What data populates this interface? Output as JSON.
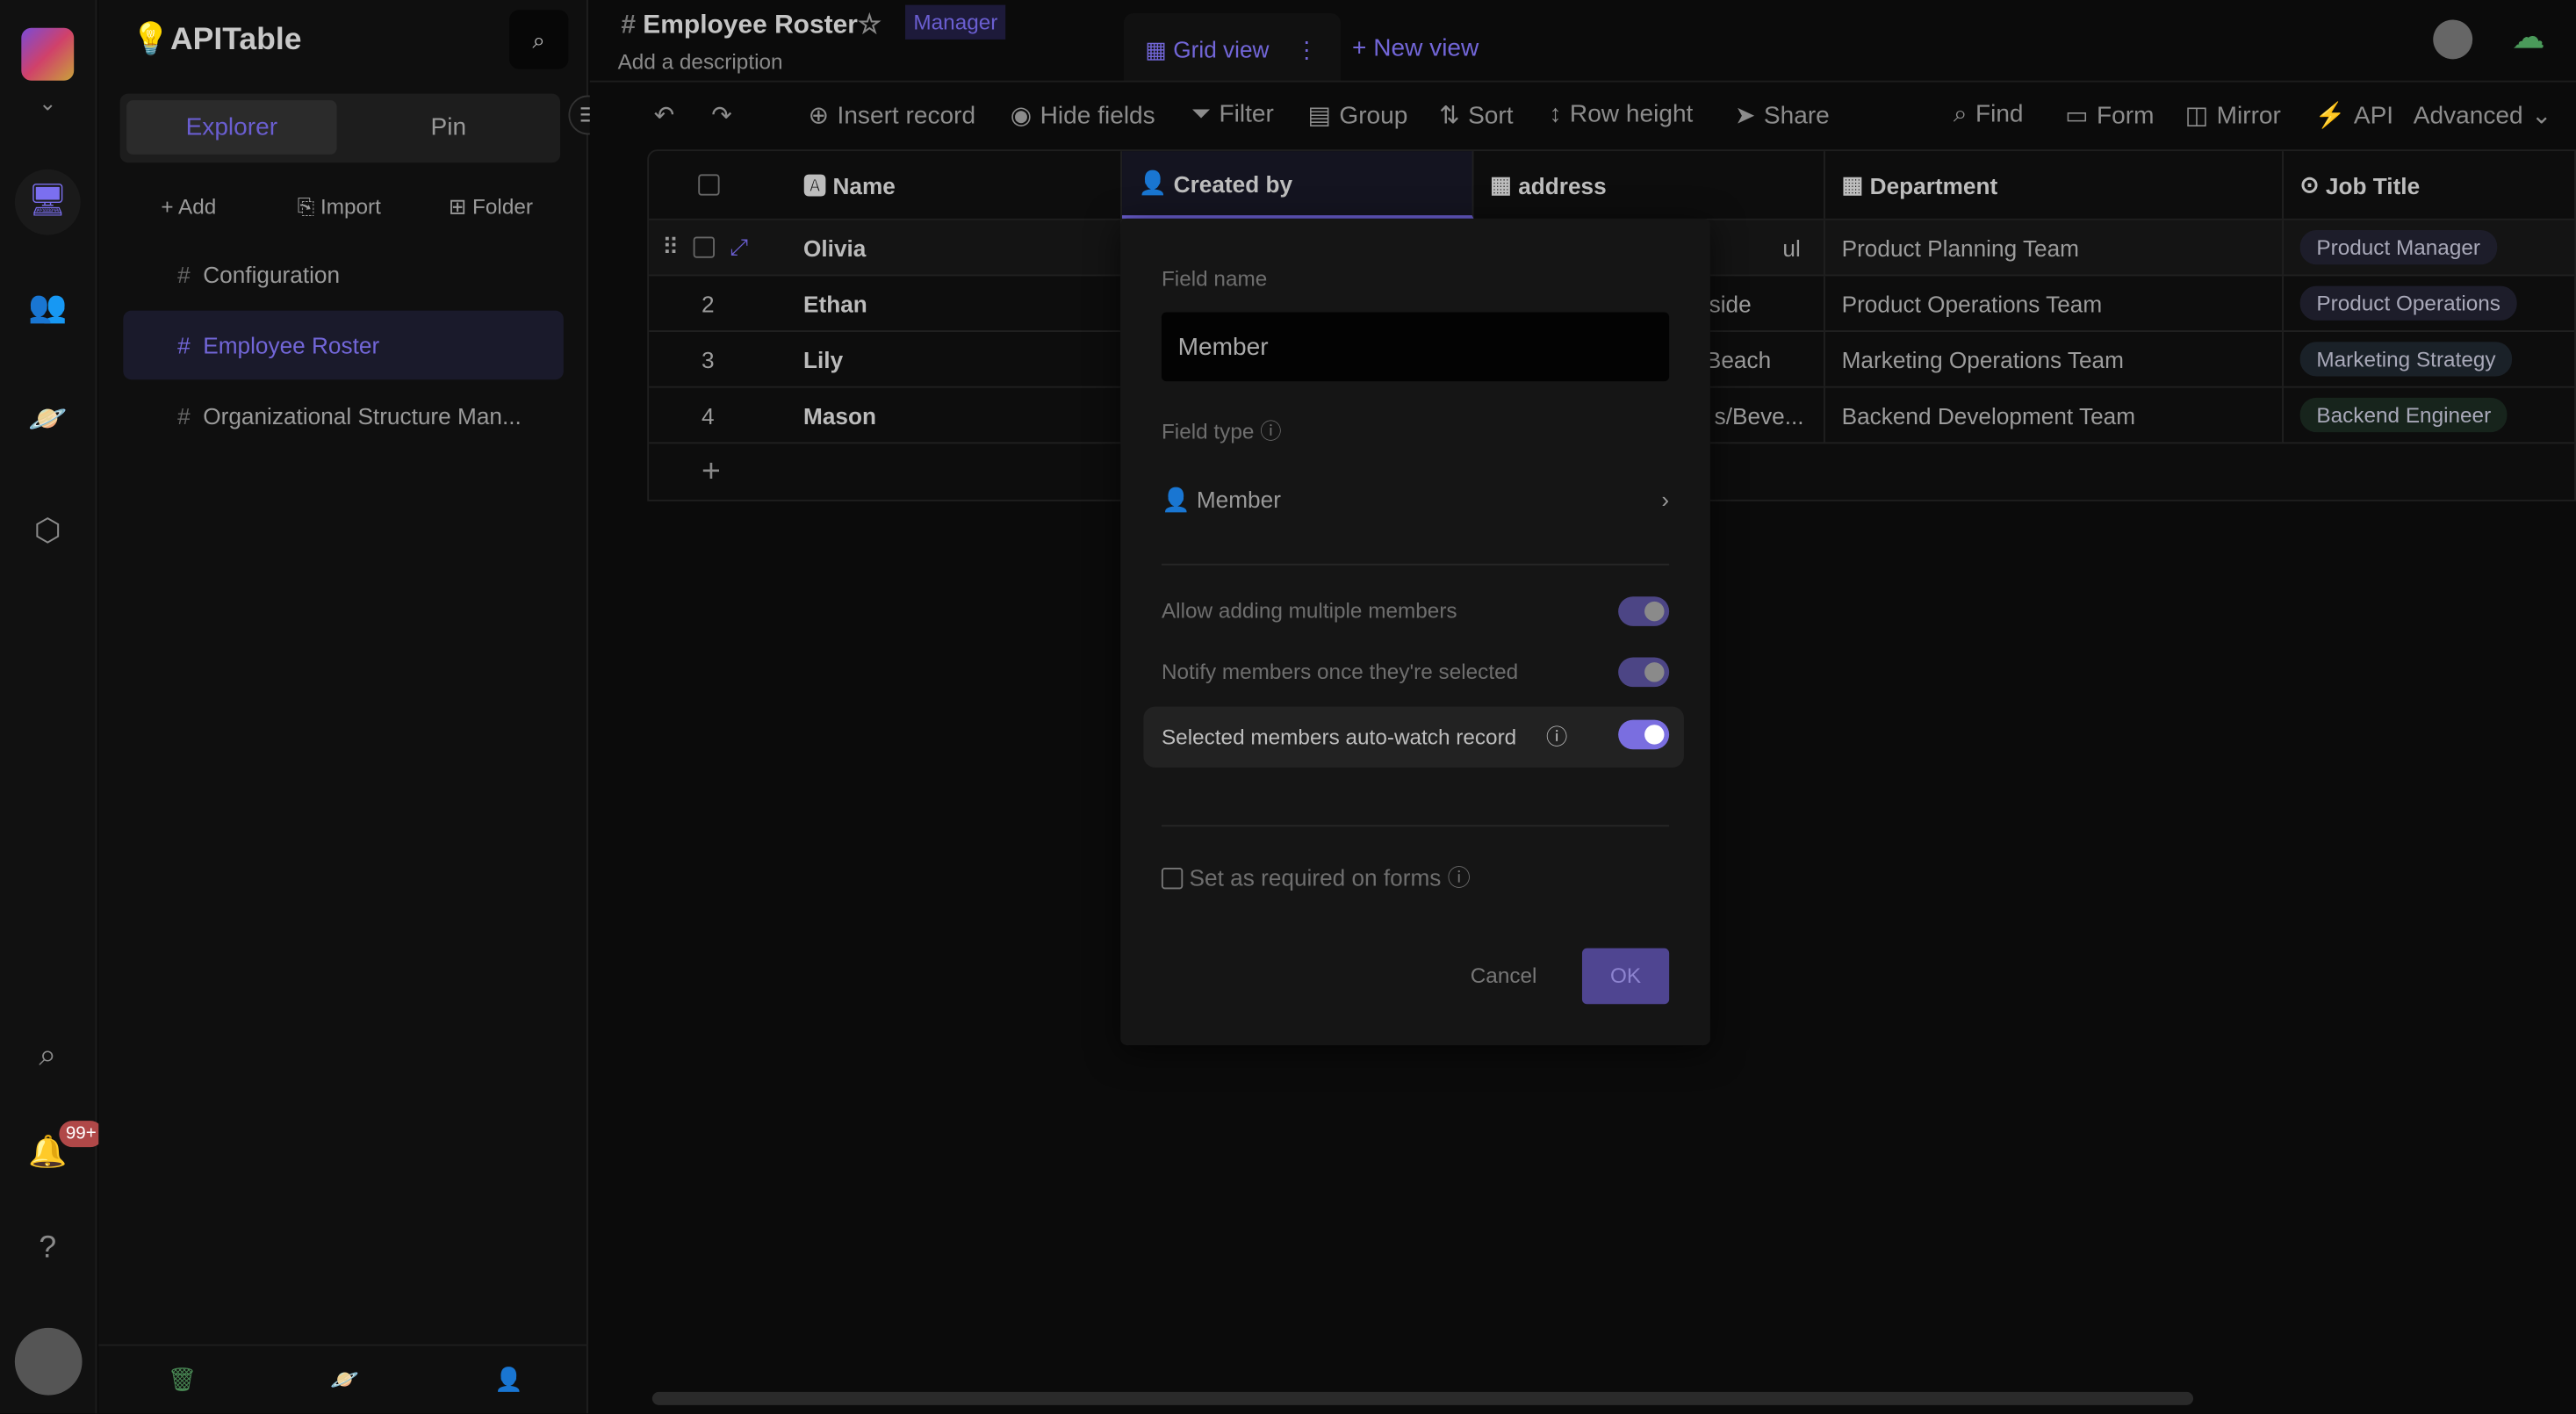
{
  "app": {
    "name": "APITable",
    "notification_count": "99+"
  },
  "sidebar": {
    "search_icon": "search-icon",
    "tabs": [
      {
        "label": "Explorer",
        "active": true
      },
      {
        "label": "Pin",
        "active": false
      }
    ],
    "actions": [
      {
        "label": "Add",
        "icon": "plus-icon"
      },
      {
        "label": "Import",
        "icon": "import-icon"
      },
      {
        "label": "Folder",
        "icon": "folder-icon"
      }
    ],
    "items": [
      {
        "label": "Configuration",
        "active": false
      },
      {
        "label": "Employee Roster",
        "active": true
      },
      {
        "label": "Organizational Structure Man...",
        "active": false
      }
    ]
  },
  "header": {
    "title": "Employee Roster",
    "role_badge": "Manager",
    "description": "Add a description",
    "views": [
      {
        "label": "Grid view",
        "active": true
      }
    ],
    "new_view": "New view"
  },
  "toolbar": {
    "left": [
      "Insert record",
      "Hide fields",
      "Filter",
      "Group",
      "Sort",
      "Row height",
      "Share"
    ],
    "right": [
      "Find",
      "Form",
      "Mirror",
      "API",
      "Advanced"
    ]
  },
  "grid": {
    "columns": [
      "Name",
      "Created by",
      "address",
      "Department",
      "Job Title"
    ],
    "rows": [
      {
        "num": "1",
        "name": "Olivia",
        "address": "ul",
        "department": "Product Planning Team",
        "job": "Product Manager"
      },
      {
        "num": "2",
        "name": "Ethan",
        "address": "side",
        "department": "Product Operations Team",
        "job": "Product Operations"
      },
      {
        "num": "3",
        "name": "Lily",
        "address": "Beach",
        "department": "Marketing Operations Team",
        "job": "Marketing Strategy"
      },
      {
        "num": "4",
        "name": "Mason",
        "address": "s/Beve...",
        "department": "Backend Development Team",
        "job": "Backend Engineer"
      }
    ]
  },
  "dialog": {
    "field_name_label": "Field name",
    "field_name_value": "Member",
    "field_type_label": "Field type",
    "field_type_value": "Member",
    "toggles": [
      {
        "label": "Allow adding multiple members",
        "on": true
      },
      {
        "label": "Notify members once they're selected",
        "on": true
      },
      {
        "label": "Selected members auto-watch record",
        "on": true
      }
    ],
    "required_label": "Set as required on forms",
    "required_checked": false,
    "cancel": "Cancel",
    "ok": "OK"
  },
  "colors": {
    "accent": "#7b6ff0",
    "background": "#0b0b0b"
  }
}
